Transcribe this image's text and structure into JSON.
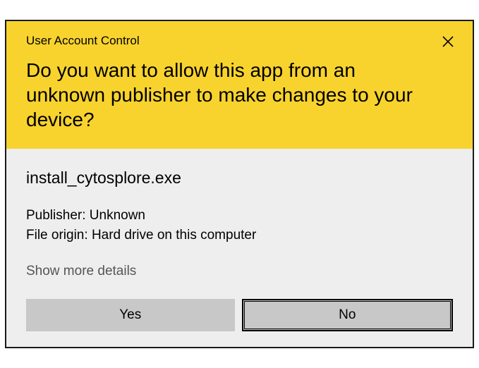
{
  "header": {
    "title": "User Account Control",
    "prompt": "Do you want to allow this app from an unknown publisher to make changes to your device?"
  },
  "body": {
    "app_name": "install_cytosplore.exe",
    "publisher_label": "Publisher:",
    "publisher_value": "Unknown",
    "origin_label": "File origin:",
    "origin_value": "Hard drive on this computer",
    "details_link": "Show more details"
  },
  "buttons": {
    "yes": "Yes",
    "no": "No"
  }
}
